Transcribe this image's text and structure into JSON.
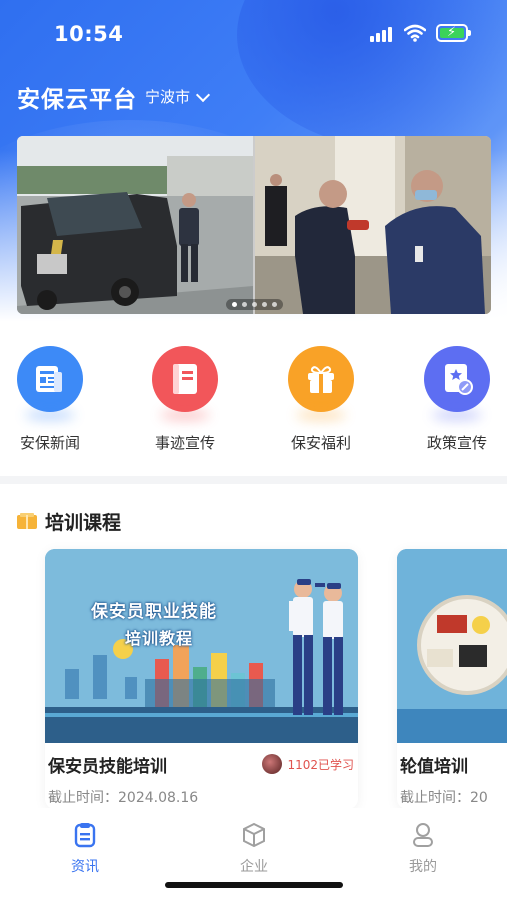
{
  "status_bar": {
    "time": "10:54"
  },
  "header": {
    "app_title": "安保云平台",
    "city": "宁波市"
  },
  "banner": {
    "slide_count": 5,
    "active_slide": 1
  },
  "quick_actions": [
    {
      "label": "安保新闻",
      "icon": "newspaper-icon",
      "color": "#3d8af7"
    },
    {
      "label": "事迹宣传",
      "icon": "document-icon",
      "color": "#f2565a"
    },
    {
      "label": "保安福利",
      "icon": "gift-icon",
      "color": "#f9a227"
    },
    {
      "label": "政策宣传",
      "icon": "policy-icon",
      "color": "#5d6ef2"
    }
  ],
  "courses_section": {
    "title": "培训课程"
  },
  "courses": [
    {
      "poster_title": "保安员职业技能",
      "poster_subtitle": "培训教程",
      "name": "保安员技能培训",
      "learned": "1102已学习",
      "deadline": "截止时间：2024.08.16"
    },
    {
      "name": "轮值培训",
      "deadline": "截止时间：20"
    }
  ],
  "tabbar": [
    {
      "label": "资讯",
      "icon": "news-tab-icon",
      "active": true
    },
    {
      "label": "企业",
      "icon": "enterprise-cube-icon",
      "active": false
    },
    {
      "label": "我的",
      "icon": "profile-icon",
      "active": false
    }
  ],
  "colors": {
    "primary": "#3a74f0",
    "accent_red": "#e0534f"
  }
}
